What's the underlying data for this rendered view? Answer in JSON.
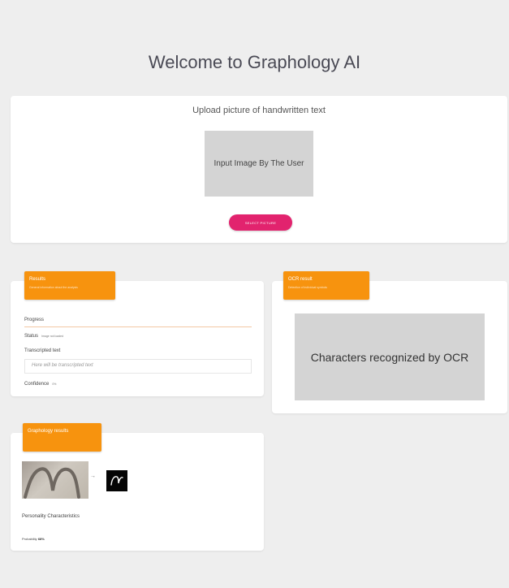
{
  "page": {
    "title": "Welcome to Graphology AI"
  },
  "upload": {
    "heading": "Upload picture of handwritten text",
    "input_image_label": "Input Image By The User",
    "select_button_label": "SELECT PICTURE"
  },
  "results": {
    "header_title": "Results",
    "header_subtitle": "General information about the analysis",
    "progress_label": "Progress",
    "progress_value": 0.0,
    "status_label": "Status",
    "status_value": "Image not loaded",
    "transcribed_label": "Transcripted text",
    "transcribed_placeholder": "Here will be transcripted text",
    "confidence_label": "Confidence",
    "confidence_value": "0%"
  },
  "ocr": {
    "header_title": "OCR result",
    "header_subtitle": "Detection of individual symbols",
    "image_label": "Characters recognized by OCR"
  },
  "graphology": {
    "header_title": "Graphology results",
    "arrow_glyph": "→",
    "personality_label": "Personality Characteristics",
    "probability_label": "Probability",
    "probability_value": "68%"
  },
  "colors": {
    "accent_orange": "#f7930e",
    "button_pink": "#e2236e",
    "background": "#eeeeee",
    "card": "#ffffff",
    "placeholder_gray": "#d4d4d4"
  }
}
